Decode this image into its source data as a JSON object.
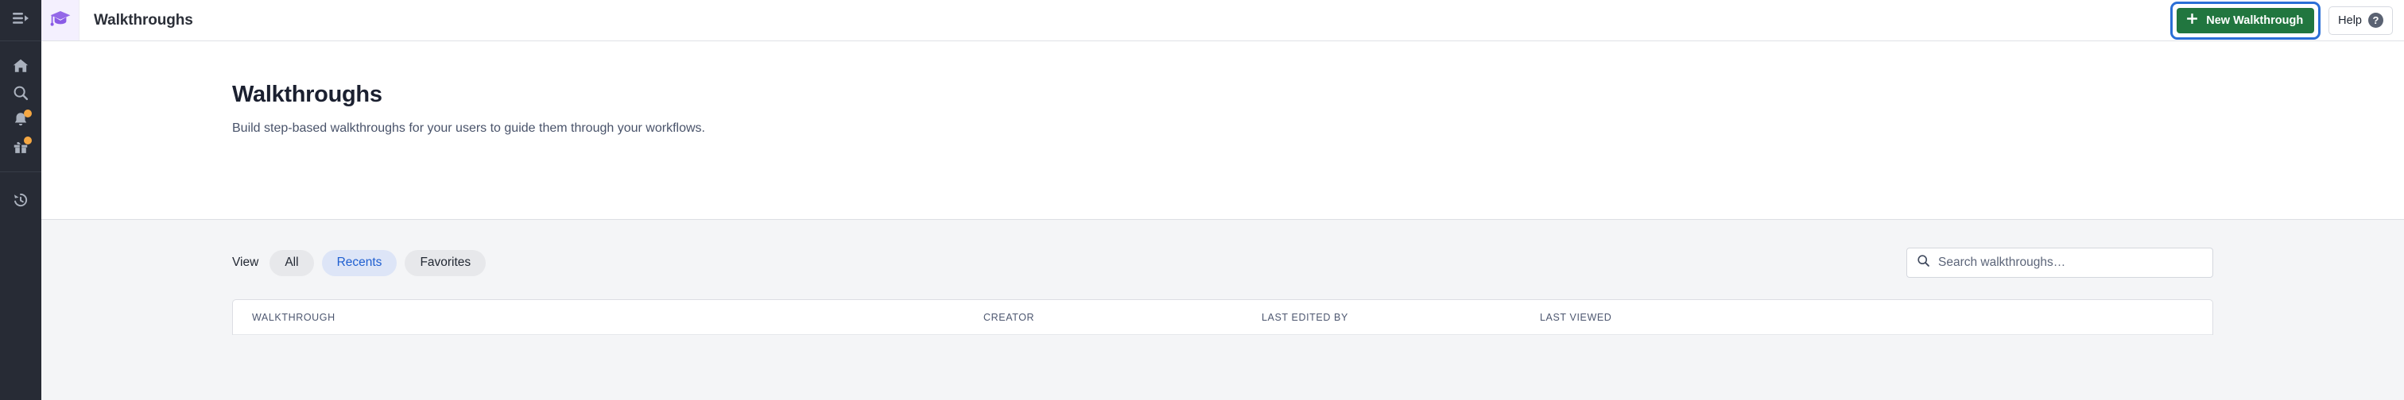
{
  "sidebar": {
    "toggle": {
      "icon": "menu-expand-icon"
    },
    "items": [
      {
        "icon": "home-icon",
        "name": "home",
        "badge": false
      },
      {
        "icon": "search-icon",
        "name": "search",
        "badge": false
      },
      {
        "icon": "bell-icon",
        "name": "notifications",
        "badge": true
      },
      {
        "icon": "gift-icon",
        "name": "whats-new",
        "badge": true
      }
    ],
    "items_secondary": [
      {
        "icon": "history-icon",
        "name": "history",
        "badge": false
      }
    ]
  },
  "topbar": {
    "logo_icon": "graduation-cap-icon",
    "title": "Walkthroughs",
    "new_button_label": "New Walkthrough",
    "new_button_icon": "plus-icon",
    "help_label": "Help",
    "help_icon": "question-circle-icon",
    "accent_green": "#21763f",
    "focus_ring": "#2b6fd6"
  },
  "page": {
    "title": "Walkthroughs",
    "subtitle": "Build step-based walkthroughs for your users to guide them through your workflows."
  },
  "toolbar": {
    "view_label": "View",
    "filters": [
      {
        "label": "All",
        "active": false
      },
      {
        "label": "Recents",
        "active": true
      },
      {
        "label": "Favorites",
        "active": false
      }
    ],
    "search": {
      "placeholder": "Search walkthroughs…",
      "value": "",
      "icon": "search-icon"
    }
  },
  "table": {
    "columns": [
      "WALKTHROUGH",
      "CREATOR",
      "LAST EDITED BY",
      "LAST VIEWED"
    ],
    "rows": []
  }
}
